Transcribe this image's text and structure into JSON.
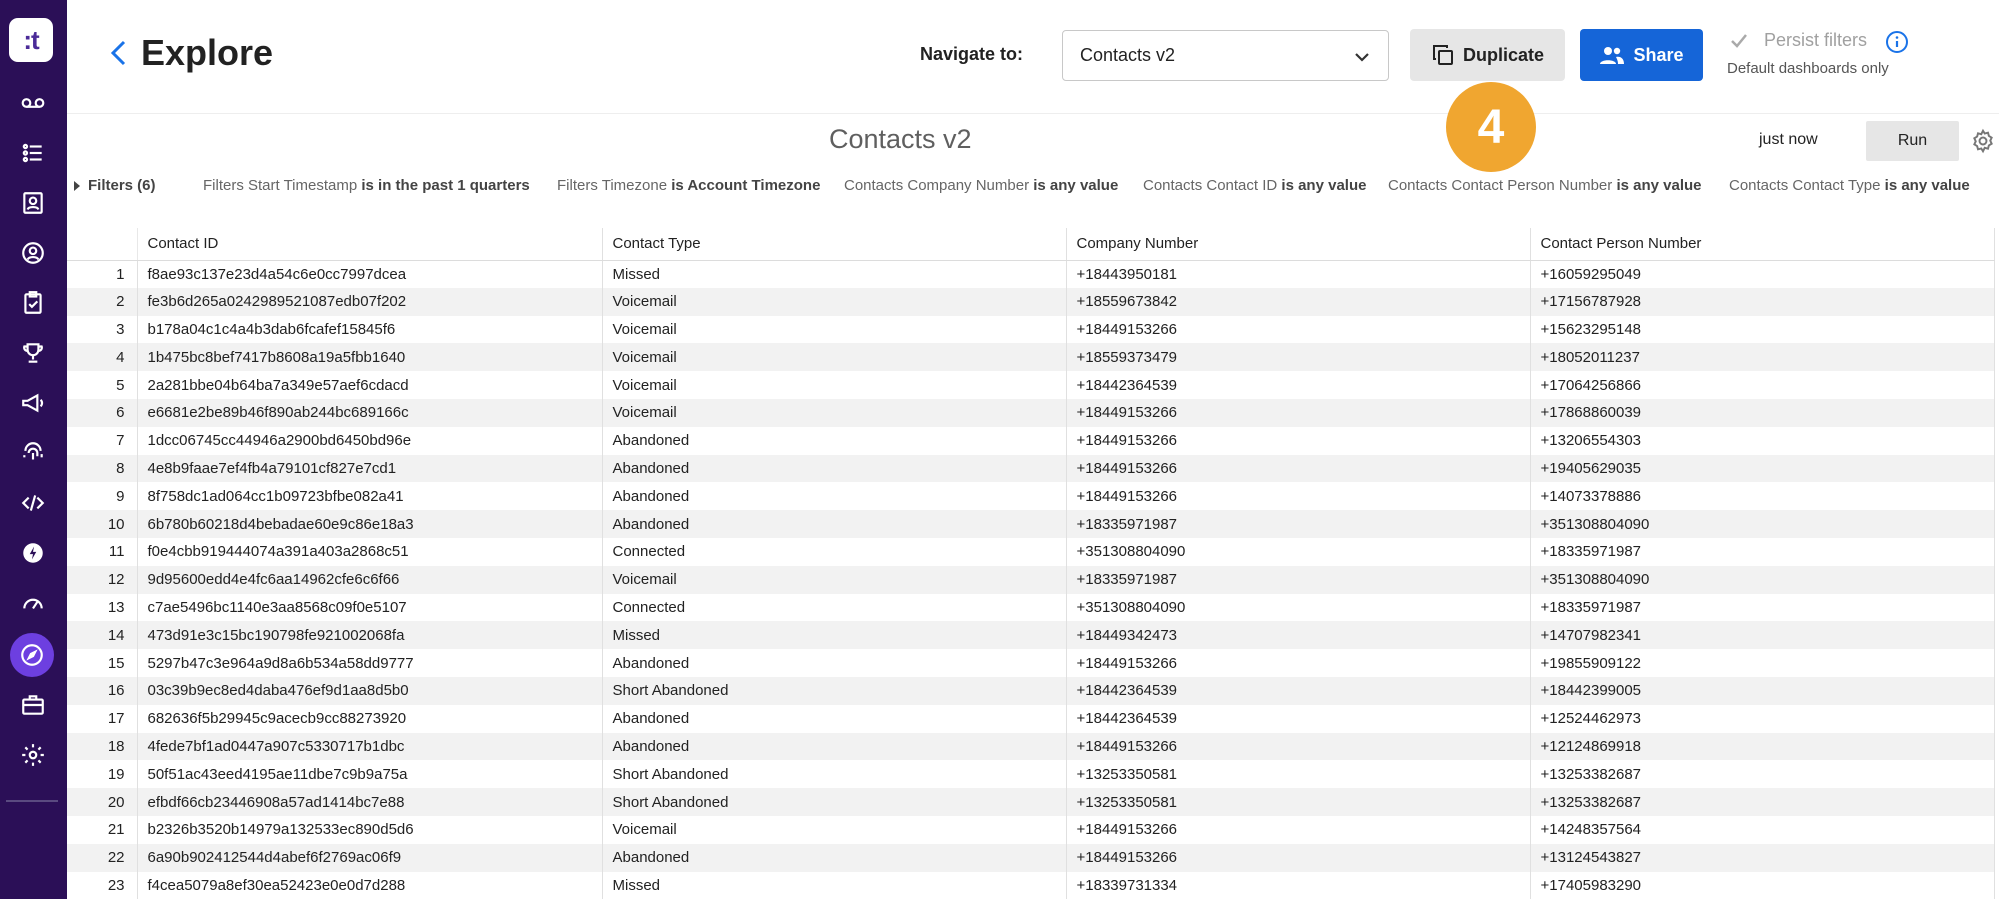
{
  "header": {
    "title": "Explore",
    "navigate_label": "Navigate to:",
    "navigate_value": "Contacts v2",
    "duplicate_label": "Duplicate",
    "share_label": "Share",
    "persist_label": "Persist filters",
    "persist_sub": "Default dashboards only"
  },
  "dashboard": {
    "title": "Contacts v2",
    "step_badge": "4",
    "updated": "just now",
    "run_label": "Run"
  },
  "filters": {
    "toggle_label": "Filters (6)",
    "items": [
      {
        "field": "Filters Start Timestamp",
        "condition": "is in the past 1 quarters"
      },
      {
        "field": "Filters Timezone",
        "condition": "is Account Timezone"
      },
      {
        "field": "Contacts Company Number",
        "condition": "is any value"
      },
      {
        "field": "Contacts Contact ID",
        "condition": "is any value"
      },
      {
        "field": "Contacts Contact Person Number",
        "condition": "is any value"
      },
      {
        "field": "Contacts Contact Type",
        "condition": "is any value"
      }
    ]
  },
  "table": {
    "columns": [
      "Contact ID",
      "Contact Type",
      "Company Number",
      "Contact Person Number"
    ],
    "rows": [
      [
        "1",
        "f8ae93c137e23d4a54c6e0cc7997dcea",
        "Missed",
        "+18443950181",
        "+16059295049"
      ],
      [
        "2",
        "fe3b6d265a0242989521087edb07f202",
        "Voicemail",
        "+18559673842",
        "+17156787928"
      ],
      [
        "3",
        "b178a04c1c4a4b3dab6fcafef15845f6",
        "Voicemail",
        "+18449153266",
        "+15623295148"
      ],
      [
        "4",
        "1b475bc8bef7417b8608a19a5fbb1640",
        "Voicemail",
        "+18559373479",
        "+18052011237"
      ],
      [
        "5",
        "2a281bbe04b64ba7a349e57aef6cdacd",
        "Voicemail",
        "+18442364539",
        "+17064256866"
      ],
      [
        "6",
        "e6681e2be89b46f890ab244bc689166c",
        "Voicemail",
        "+18449153266",
        "+17868860039"
      ],
      [
        "7",
        "1dcc06745cc44946a2900bd6450bd96e",
        "Abandoned",
        "+18449153266",
        "+13206554303"
      ],
      [
        "8",
        "4e8b9faae7ef4fb4a79101cf827e7cd1",
        "Abandoned",
        "+18449153266",
        "+19405629035"
      ],
      [
        "9",
        "8f758dc1ad064cc1b09723bfbe082a41",
        "Abandoned",
        "+18449153266",
        "+14073378886"
      ],
      [
        "10",
        "6b780b60218d4bebadae60e9c86e18a3",
        "Abandoned",
        "+18335971987",
        "+351308804090"
      ],
      [
        "11",
        "f0e4cbb919444074a391a403a2868c51",
        "Connected",
        "+351308804090",
        "+18335971987"
      ],
      [
        "12",
        "9d95600edd4e4fc6aa14962cfe6c6f66",
        "Voicemail",
        "+18335971987",
        "+351308804090"
      ],
      [
        "13",
        "c7ae5496bc1140e3aa8568c09f0e5107",
        "Connected",
        "+351308804090",
        "+18335971987"
      ],
      [
        "14",
        "473d91e3c15bc190798fe921002068fa",
        "Missed",
        "+18449342473",
        "+14707982341"
      ],
      [
        "15",
        "5297b47c3e964a9d8a6b534a58dd9777",
        "Abandoned",
        "+18449153266",
        "+19855909122"
      ],
      [
        "16",
        "03c39b9ec8ed4daba476ef9d1aa8d5b0",
        "Short Abandoned",
        "+18442364539",
        "+18442399005"
      ],
      [
        "17",
        "682636f5b29945c9acecb9cc88273920",
        "Abandoned",
        "+18442364539",
        "+12524462973"
      ],
      [
        "18",
        "4fede7bf1ad0447a907c5330717b1dbc",
        "Abandoned",
        "+18449153266",
        "+12124869918"
      ],
      [
        "19",
        "50f51ac43eed4195ae11dbe7c9b9a75a",
        "Short Abandoned",
        "+13253350581",
        "+13253382687"
      ],
      [
        "20",
        "efbdf66cb23446908a57ad1414bc7e88",
        "Short Abandoned",
        "+13253350581",
        "+13253382687"
      ],
      [
        "21",
        "b2326b3520b14979a132533ec890d5d6",
        "Voicemail",
        "+18449153266",
        "+14248357564"
      ],
      [
        "22",
        "6a90b902412544d4abef6f2769ac06f9",
        "Abandoned",
        "+18449153266",
        "+13124543827"
      ],
      [
        "23",
        "f4cea5079a8ef30ea52423e0e0d7d288",
        "Missed",
        "+18339731334",
        "+17405983290"
      ]
    ]
  },
  "sidebar": {
    "items": [
      "voicemail-icon",
      "list-icon",
      "contact-card-icon",
      "agent-icon",
      "clipboard-icon",
      "trophy-icon",
      "megaphone-icon",
      "fingerprint-icon",
      "code-icon",
      "lightning-icon",
      "gauge-icon",
      "compass-icon",
      "briefcase-icon",
      "gear-icon"
    ],
    "active": "compass-icon"
  },
  "colors": {
    "sidebar_bg": "#2b0f57",
    "sidebar_active": "#6d3fe0",
    "share_button": "#1565d8",
    "step_badge": "#f0a630",
    "accent_blue": "#1a73e8"
  }
}
